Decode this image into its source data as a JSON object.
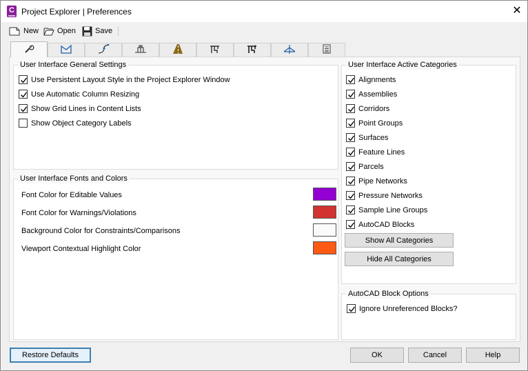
{
  "window": {
    "title": "Project Explorer | Preferences",
    "icon_letter": "C",
    "close_glyph": "✕"
  },
  "toolbar": {
    "new_label": "New",
    "open_label": "Open",
    "save_label": "Save"
  },
  "tabs": [
    {
      "icon": "wrench-icon",
      "active": true
    },
    {
      "icon": "surface-icon"
    },
    {
      "icon": "alignment-icon"
    },
    {
      "icon": "assembly-icon"
    },
    {
      "icon": "corridor-icon"
    },
    {
      "icon": "pipe-network-icon"
    },
    {
      "icon": "pressure-network-icon"
    },
    {
      "icon": "feature-line-icon"
    },
    {
      "icon": "table-icon"
    }
  ],
  "general": {
    "title": "User Interface General Settings",
    "items": [
      {
        "label": "Use Persistent Layout Style in the Project Explorer Window",
        "checked": true
      },
      {
        "label": "Use Automatic Column Resizing",
        "checked": true
      },
      {
        "label": "Show Grid Lines in Content Lists",
        "checked": true
      },
      {
        "label": "Show Object Category Labels",
        "checked": false
      }
    ]
  },
  "fonts": {
    "title": "User Interface Fonts and Colors",
    "items": [
      {
        "label": "Font Color for Editable Values",
        "color": "#9400d3"
      },
      {
        "label": "Font Color for Warnings/Violations",
        "color": "#d23232"
      },
      {
        "label": "Background Color for Constraints/Comparisons",
        "color": "#fafafa"
      },
      {
        "label": "Viewport Contextual Highlight Color",
        "color": "#ff5a14"
      }
    ]
  },
  "categories": {
    "title": "User Interface Active Categories",
    "items": [
      {
        "label": "Alignments",
        "checked": true
      },
      {
        "label": "Assemblies",
        "checked": true
      },
      {
        "label": "Corridors",
        "checked": true
      },
      {
        "label": "Point Groups",
        "checked": true
      },
      {
        "label": "Surfaces",
        "checked": true
      },
      {
        "label": "Feature Lines",
        "checked": true
      },
      {
        "label": "Parcels",
        "checked": true
      },
      {
        "label": "Pipe Networks",
        "checked": true
      },
      {
        "label": "Pressure Networks",
        "checked": true
      },
      {
        "label": "Sample Line Groups",
        "checked": true
      },
      {
        "label": "AutoCAD Blocks",
        "checked": true
      }
    ],
    "show_all_label": "Show All Categories",
    "hide_all_label": "Hide All Categories"
  },
  "block_options": {
    "title": "AutoCAD Block Options",
    "ignore_label": "Ignore Unreferenced Blocks?",
    "ignore_checked": true
  },
  "footer": {
    "restore_label": "Restore Defaults",
    "ok_label": "OK",
    "cancel_label": "Cancel",
    "help_label": "Help"
  }
}
